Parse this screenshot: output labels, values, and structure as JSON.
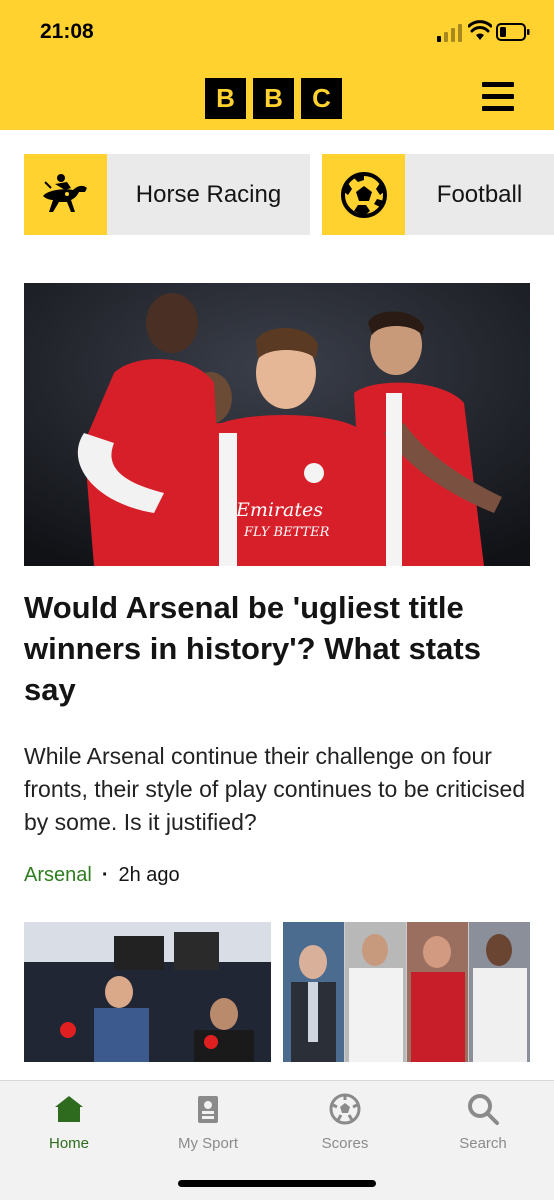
{
  "status_bar": {
    "time": "21:08"
  },
  "header": {
    "logo_letters": [
      "B",
      "B",
      "C"
    ],
    "brand_color": "#ffd230"
  },
  "sport_tiles": [
    {
      "label": "Horse Racing",
      "icon": "horse-racing-icon"
    },
    {
      "label": "Football",
      "icon": "football-icon"
    }
  ],
  "lead_story": {
    "headline": "Would Arsenal be 'ugliest title winners in history'? What stats say",
    "summary": "While Arsenal continue their challenge on four fronts, their style of play continues to be criticised by some. Is it justified?",
    "tag": "Arsenal",
    "time": "2h ago",
    "image_text": [
      "Emirates",
      "FLY BETTER"
    ]
  },
  "bottom_nav": {
    "items": [
      {
        "label": "Home",
        "icon": "home-icon",
        "active": true
      },
      {
        "label": "My Sport",
        "icon": "my-sport-icon",
        "active": false
      },
      {
        "label": "Scores",
        "icon": "scores-icon",
        "active": false
      },
      {
        "label": "Search",
        "icon": "search-icon",
        "active": false
      }
    ]
  },
  "colors": {
    "accent_green": "#2e7d1f",
    "nav_active": "#2e6b1f",
    "nav_inactive": "#8b8b8b"
  }
}
